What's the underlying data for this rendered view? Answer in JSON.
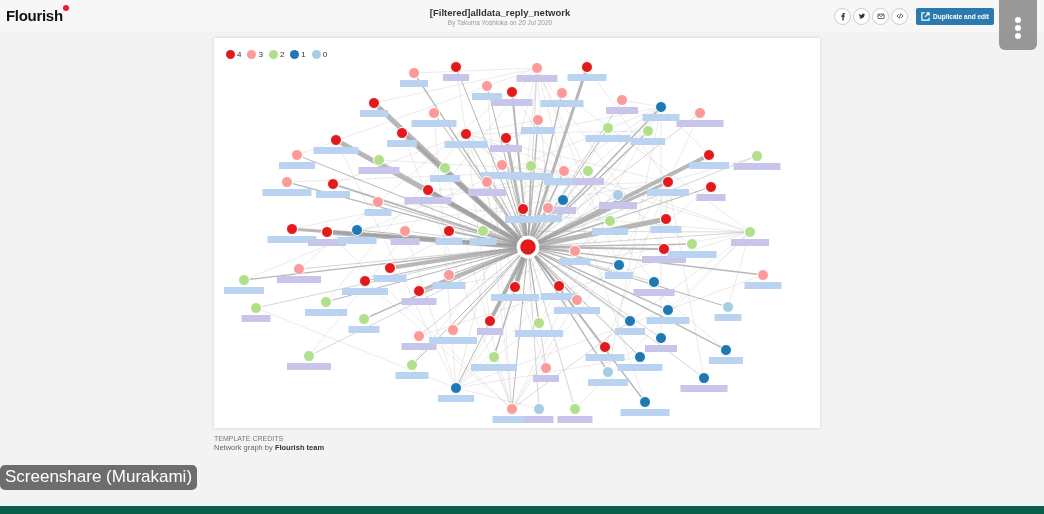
{
  "header": {
    "logo": "Flourish",
    "title": "[Filtered]alldata_reply_network",
    "byline": "By Takuma Yoshioka on 20 Jul 2020",
    "share_buttons": [
      {
        "kind": "facebook"
      },
      {
        "kind": "twitter"
      },
      {
        "kind": "email"
      },
      {
        "kind": "embed"
      }
    ],
    "duplicate_button": "Duplicate and edit"
  },
  "graph": {
    "legend": [
      {
        "label": "4",
        "color": "#e31a1c"
      },
      {
        "label": "3",
        "color": "#fb9a99"
      },
      {
        "label": "2",
        "color": "#b2df8a"
      },
      {
        "label": "1",
        "color": "#1f78b4"
      },
      {
        "label": "0",
        "color": "#a6cee3"
      }
    ],
    "nodes": [
      {
        "color": "#e31a1c"
      },
      {
        "color": "#e31a1c"
      },
      {
        "color": "#e31a1c"
      },
      {
        "color": "#e31a1c"
      },
      {
        "color": "#e31a1c"
      },
      {
        "color": "#e31a1c"
      },
      {
        "color": "#e31a1c"
      },
      {
        "color": "#e31a1c"
      },
      {
        "color": "#e31a1c"
      },
      {
        "color": "#e31a1c"
      },
      {
        "color": "#e31a1c"
      },
      {
        "color": "#e31a1c"
      },
      {
        "color": "#e31a1c"
      },
      {
        "color": "#e31a1c"
      },
      {
        "color": "#e31a1c"
      },
      {
        "color": "#e31a1c"
      },
      {
        "color": "#e31a1c"
      },
      {
        "color": "#e31a1c"
      },
      {
        "color": "#e31a1c"
      },
      {
        "color": "#e31a1c"
      },
      {
        "color": "#e31a1c"
      },
      {
        "color": "#e31a1c"
      },
      {
        "color": "#e31a1c"
      },
      {
        "color": "#e31a1c"
      },
      {
        "color": "#e31a1c"
      },
      {
        "color": "#e31a1c"
      },
      {
        "color": "#fb9a99"
      },
      {
        "color": "#fb9a99"
      },
      {
        "color": "#fb9a99"
      },
      {
        "color": "#fb9a99"
      },
      {
        "color": "#fb9a99"
      },
      {
        "color": "#fb9a99"
      },
      {
        "color": "#fb9a99"
      },
      {
        "color": "#fb9a99"
      },
      {
        "color": "#fb9a99"
      },
      {
        "color": "#fb9a99"
      },
      {
        "color": "#fb9a99"
      },
      {
        "color": "#fb9a99"
      },
      {
        "color": "#fb9a99"
      },
      {
        "color": "#fb9a99"
      },
      {
        "color": "#fb9a99"
      },
      {
        "color": "#fb9a99"
      },
      {
        "color": "#fb9a99"
      },
      {
        "color": "#fb9a99"
      },
      {
        "color": "#fb9a99"
      },
      {
        "color": "#fb9a99"
      },
      {
        "color": "#fb9a99"
      },
      {
        "color": "#fb9a99"
      },
      {
        "color": "#fb9a99"
      },
      {
        "color": "#fb9a99"
      },
      {
        "color": "#fb9a99"
      },
      {
        "color": "#b2df8a"
      },
      {
        "color": "#b2df8a"
      },
      {
        "color": "#b2df8a"
      },
      {
        "color": "#b2df8a"
      },
      {
        "color": "#b2df8a"
      },
      {
        "color": "#b2df8a"
      },
      {
        "color": "#b2df8a"
      },
      {
        "color": "#b2df8a"
      },
      {
        "color": "#b2df8a"
      },
      {
        "color": "#b2df8a"
      },
      {
        "color": "#b2df8a"
      },
      {
        "color": "#b2df8a"
      },
      {
        "color": "#b2df8a"
      },
      {
        "color": "#b2df8a"
      },
      {
        "color": "#b2df8a"
      },
      {
        "color": "#b2df8a"
      },
      {
        "color": "#b2df8a"
      },
      {
        "color": "#b2df8a"
      },
      {
        "color": "#b2df8a"
      },
      {
        "color": "#b2df8a"
      },
      {
        "color": "#1f78b4"
      },
      {
        "color": "#1f78b4"
      },
      {
        "color": "#1f78b4"
      },
      {
        "color": "#1f78b4"
      },
      {
        "color": "#1f78b4"
      },
      {
        "color": "#1f78b4"
      },
      {
        "color": "#1f78b4"
      },
      {
        "color": "#1f78b4"
      },
      {
        "color": "#1f78b4"
      },
      {
        "color": "#1f78b4"
      },
      {
        "color": "#1f78b4"
      },
      {
        "color": "#1f78b4"
      },
      {
        "color": "#1f78b4"
      },
      {
        "color": "#a6cee3"
      },
      {
        "color": "#a6cee3"
      },
      {
        "color": "#a6cee3"
      },
      {
        "color": "#a6cee3"
      }
    ],
    "hub": {
      "color": "#e31a1c"
    }
  },
  "credits": {
    "heading": "TEMPLATE CREDITS",
    "text": "Network graph by **Flourish team**"
  },
  "screenshare_label": "Screenshare (Murakami)"
}
